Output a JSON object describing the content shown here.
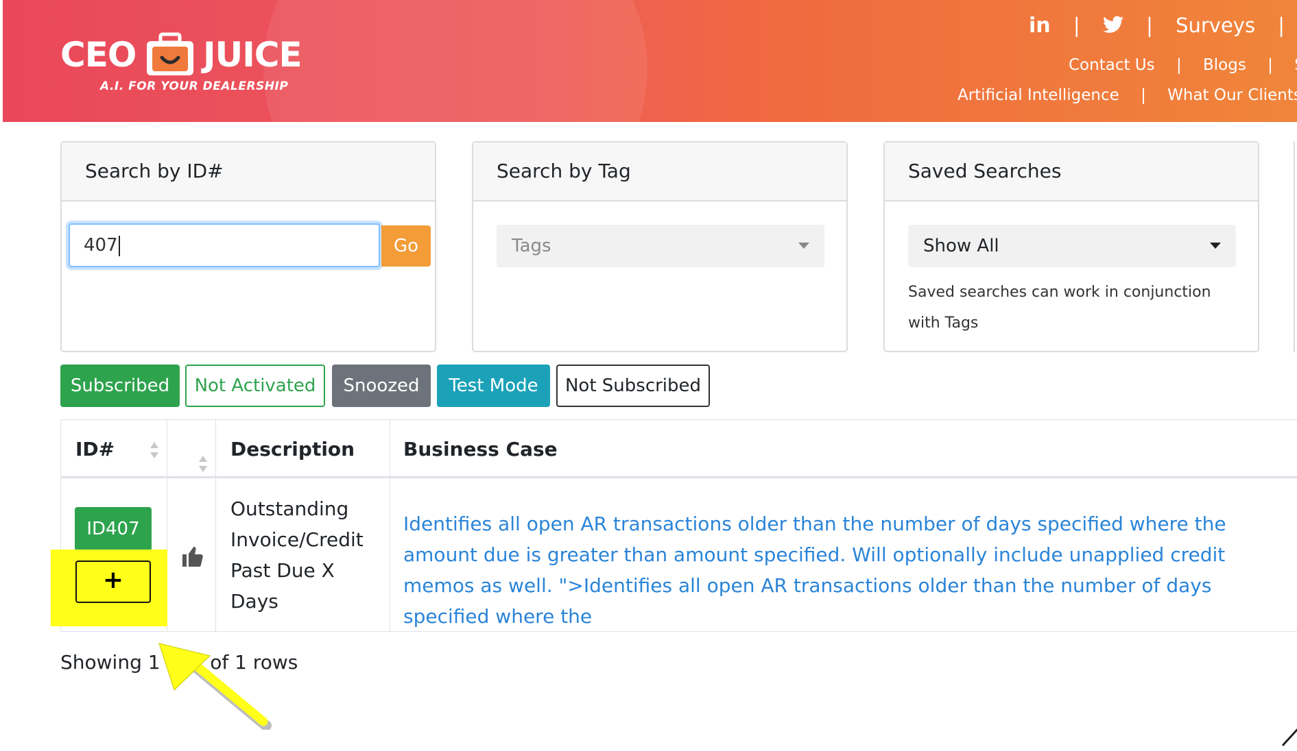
{
  "header": {
    "logo": {
      "ceo": "CEO",
      "juice": "JUICE",
      "tagline": "A.I. FOR YOUR DEALERSHIP"
    },
    "nav_row1": [
      "in",
      "|",
      "Surveys",
      "|"
    ],
    "nav_row2": [
      "Contact Us",
      "|",
      "Blogs",
      "|",
      "Su"
    ],
    "nav_row3": [
      "Artificial Intelligence",
      "|",
      "What Our Clients Sa"
    ]
  },
  "cards": {
    "search_id": {
      "title": "Search by ID#",
      "value": "407",
      "go_label": "Go"
    },
    "search_tag": {
      "title": "Search by Tag",
      "placeholder": "Tags"
    },
    "saved": {
      "title": "Saved Searches",
      "selected": "Show All",
      "help": "Saved searches can work in conjunction with Tags"
    }
  },
  "filters": {
    "subscribed": "Subscribed",
    "not_activated": "Not Activated",
    "snoozed": "Snoozed",
    "test_mode": "Test Mode",
    "not_subscribed": "Not Subscribed"
  },
  "table": {
    "headers": {
      "id": "ID#",
      "description": "Description",
      "business_case": "Business Case"
    },
    "rows": [
      {
        "id": "ID407",
        "plus": "+",
        "description": "Outstanding Invoice/Credit Past Due X Days",
        "business_case": "Identifies all open AR transactions older than the number of days specified where the amount due is greater than amount specified. Will optionally include unapplied credit memos as well. \">Identifies all open AR transactions older than the number of days specified where the"
      }
    ],
    "footer": "Showing 1 to 1 of 1 rows"
  },
  "colors": {
    "header_start": "#e9485a",
    "header_end": "#f0853a",
    "subscribed": "#2ea34d",
    "snoozed": "#6c737a",
    "test_mode": "#1ba2b8",
    "go": "#f39c38",
    "link": "#2a84d8",
    "highlight": "#ffff1a"
  }
}
